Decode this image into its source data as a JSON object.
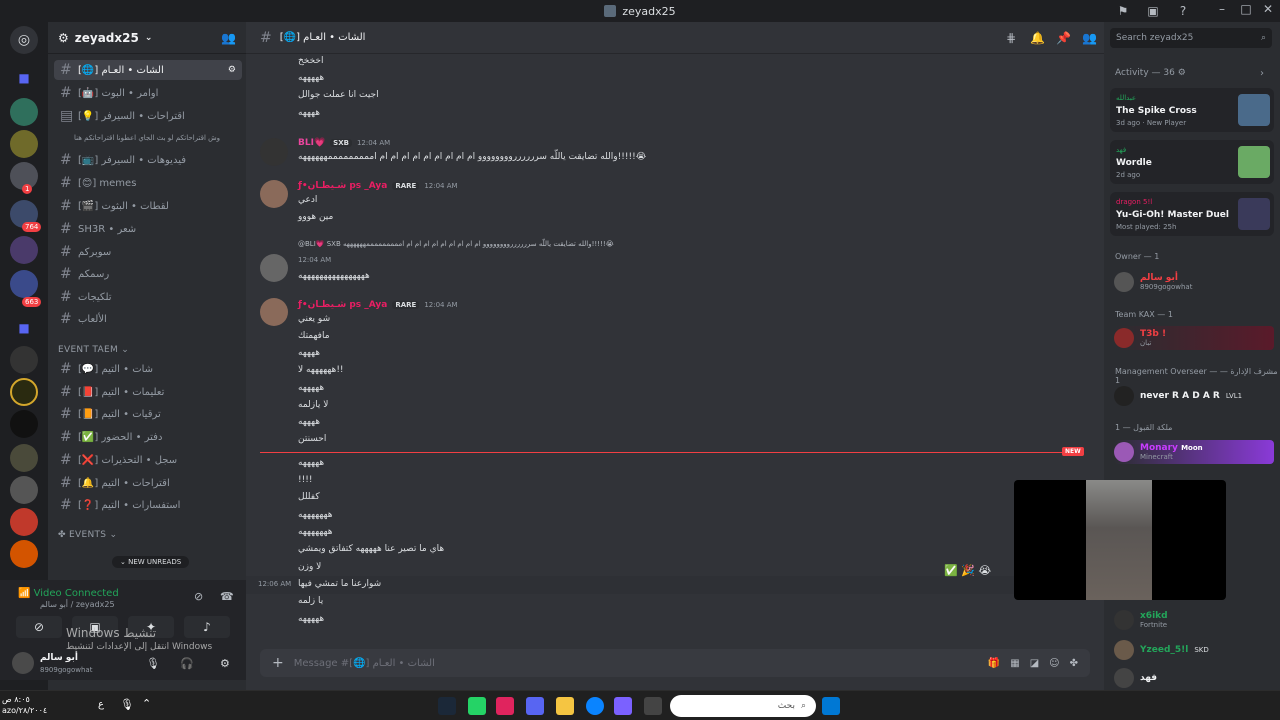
{
  "window": {
    "title": "zeyadx25"
  },
  "guild": {
    "name": "zeyadx25"
  },
  "channels": [
    {
      "label": "[🌐] الشات • العـام",
      "active": true
    },
    {
      "label": "[🤖] اوامر • البوت"
    },
    {
      "label": "[💡] اقتراحات • السيرفر"
    },
    {
      "label": "وش اقتراحاتكم لو بث الجاي اعطونا اقتراحاتكم هنا"
    },
    {
      "label": "[📺] فيديوهات • السيرفر"
    },
    {
      "label": "[😊] memes"
    },
    {
      "label": "[🎬] لقطات • البثوت"
    },
    {
      "label": "SH3R • شعر"
    },
    {
      "label": "سوبركم"
    },
    {
      "label": "رسمكم"
    },
    {
      "label": "تلكيجات"
    },
    {
      "label": "الألعاب"
    }
  ],
  "event_category": "EVENT TAEM",
  "event_channels": [
    {
      "label": "[💬] شات • التيم"
    },
    {
      "label": "[📕] تعليمات • التيم"
    },
    {
      "label": "[📙] ترقيات • التيم"
    },
    {
      "label": "[✅] دفتر • الحضور"
    },
    {
      "label": "[❌] سجل • التحذيرات"
    },
    {
      "label": "[🔔] اقتراحات • التيم"
    },
    {
      "label": "[❓] استفسارات • التيم"
    }
  ],
  "events_category": "EVENTS",
  "new_unreads": "NEW UNREADS",
  "voice": {
    "status": "Video Connected",
    "channel": "أبو سالم / zeyadx25"
  },
  "user": {
    "name": "أبو سالم",
    "status": "8909gogowhat"
  },
  "activation": {
    "line1": "Windows تنشيط",
    "line2": "انتقل إلى الإعدادات لتنشيط Windows"
  },
  "chat": {
    "channel_title": "[🌐] الشات • العـام",
    "composer_placeholder": "Message #[🌐] الشات • العـام",
    "top_lines": [
      "اخخخخ",
      "هههههه",
      "اجيت انا عملت جوالل",
      "ههههه"
    ],
    "msg_bli": {
      "author": "BLI💗",
      "tag": "SXB",
      "time": "12:04 AM",
      "text": "والله تضايقت ياللّه سرررررروووووووو ام ام ام ام ام ام ام ام ام امممممممممههههههه!!!!!😭"
    },
    "msg_aya1": {
      "author": "ƒ•شـيطـان ps _Aya",
      "tag": "RARE",
      "time": "12:04 AM",
      "lines": [
        "ادعي",
        "مين هووو"
      ]
    },
    "reply_preview": "@BLI💗 SXB والله تضايقت ياللّه سرررررروووووووو ام ام ام ام ام ام ام ام ام امممممممممههههههه!!!!!😭",
    "msg_reply": {
      "time": "12:04 AM",
      "text": "ههههههههههههههههه"
    },
    "msg_aya2": {
      "author": "ƒ•شـيطـان ps _Aya",
      "tag": "RARE",
      "time": "12:04 AM",
      "lines": [
        "شو يعني",
        "مافهمتك",
        "ههههه",
        "ههههههه لا!!",
        "هههههه",
        "لا يازلمه",
        "ههههه",
        "احسنتن"
      ]
    },
    "new_marker": "NEW",
    "after_lines": [
      "هههههه",
      "!!!!",
      "كفللل",
      "هههههههه",
      "هههههههه",
      "هاي ما تصير عنا هههههه كتفاتق ويمشي",
      "لا وزن",
      "شوارعنا ما تمشي فيها",
      "يا زلمه",
      "هههههه"
    ],
    "hover_time": "12:06 AM"
  },
  "members": {
    "search_placeholder": "Search zeyadx25",
    "activity_header": "Activity — 36",
    "activities": [
      {
        "user": "عبدالله",
        "game": "The Spike Cross",
        "meta": "3d ago",
        "extra": "New Player"
      },
      {
        "user": "فهد",
        "game": "Wordle",
        "meta": "2d ago"
      },
      {
        "user": "dragon 5!l",
        "game": "Yu-Gi-Oh! Master Duel",
        "meta": "Most played: 25h"
      }
    ],
    "owner_header": "Owner — 1",
    "owner": {
      "name": "أبو سالم",
      "status": "8909gogowhat"
    },
    "team_header": "Team KAX — 1",
    "team": {
      "name": "T3b !",
      "status": "تبان"
    },
    "mgmt_header": "Management Overseer — مشرف الإدارة — 1",
    "mgmt": {
      "name": "never R A D A R",
      "tag": "LVL1"
    },
    "queen_header": "ملكة القبول — 1",
    "queen": {
      "name": "Monary",
      "tag": "Moon",
      "status": "Minecraft"
    },
    "others": [
      {
        "name": "x6ikd",
        "status": "Fortnite"
      },
      {
        "name": "Yzeed_5!l",
        "tag": "SKD"
      },
      {
        "name": "فهد"
      }
    ]
  },
  "taskbar": {
    "search": "بحث",
    "clock": "٨:٠٥ ص",
    "date": "azo/٢٨/٢٠٠٤"
  },
  "colors": {
    "accent": "#5865f2",
    "danger": "#f23f43",
    "online": "#23a55a",
    "pink": "#e91e63"
  }
}
